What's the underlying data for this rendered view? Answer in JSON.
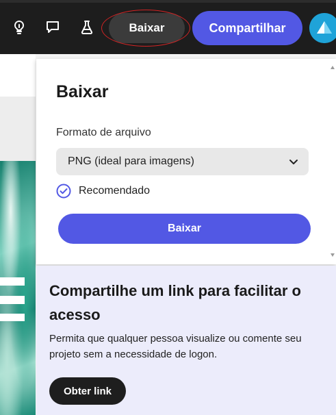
{
  "topbar": {
    "icons": [
      "lightbulb-icon",
      "comment-icon",
      "flask-icon"
    ],
    "download_label": "Baixar",
    "share_label": "Compartilhar",
    "colors": {
      "bar": "#1d1d1d",
      "accent": "#5258e4",
      "annotation": "#d32424"
    }
  },
  "download_panel": {
    "title": "Baixar",
    "format_label": "Formato de arquivo",
    "format_value": "PNG (ideal para imagens)",
    "recommended_label": "Recomendado",
    "button_label": "Baixar"
  },
  "share_panel": {
    "title": "Compartilhe um link para facilitar o acesso",
    "description": "Permita que qualquer pessoa visualize ou comente seu projeto sem a necessidade de logon.",
    "button_label": "Obter link",
    "background": "#ececfb"
  }
}
